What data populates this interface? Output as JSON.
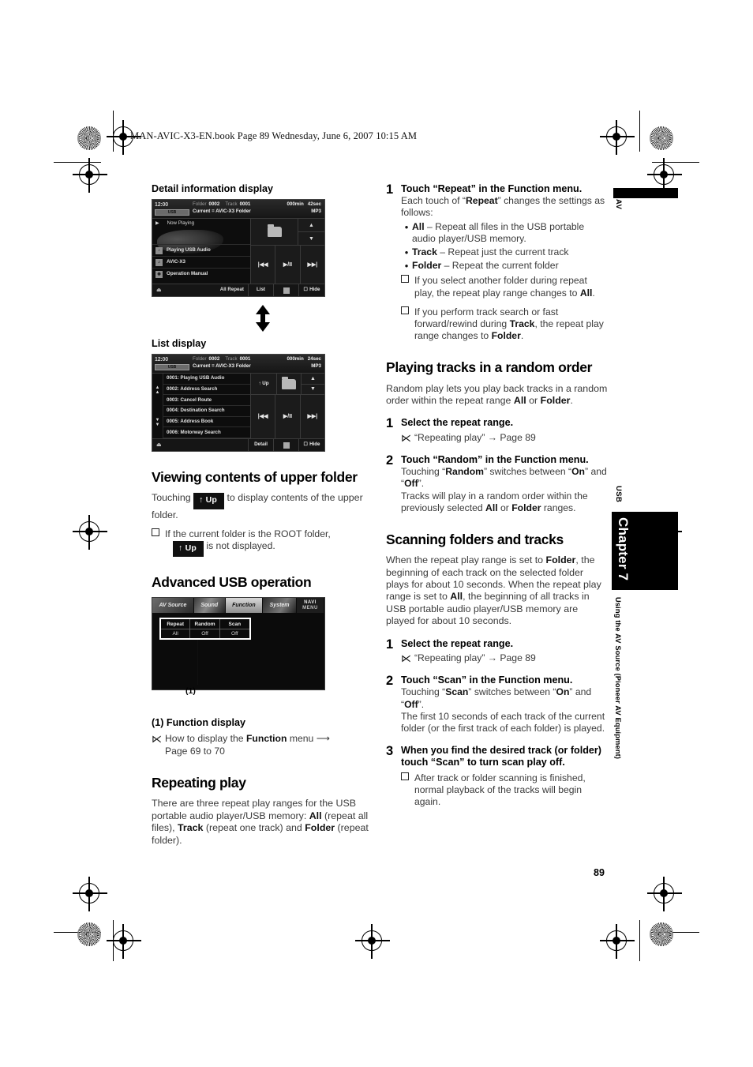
{
  "page": {
    "file_header": "MAN-AVIC-X3-EN.book  Page 89  Wednesday, June 6, 2007  10:15 AM",
    "page_number": "89",
    "margin": {
      "av_label": "AV",
      "usb_label": "USB",
      "chapter_label": "Chapter 7",
      "chapter_subtitle": "Using the AV Source (Pioneer AV Equipment)"
    }
  },
  "left_column": {
    "detail_caption": "Detail information display",
    "list_caption": "List display",
    "detail_screen": {
      "clock": "12:00",
      "clock_badge": "USB",
      "folder_label": "Folder",
      "folder_value": "0002",
      "track_label": "Track",
      "track_value": "0001",
      "elapsed": "000min",
      "seconds": "42sec",
      "format": "MP3",
      "current_label": "Current = AVIC-X3 Folder",
      "now_playing": "Now Playing",
      "info_rows": [
        "Playing USB Audio",
        "AVIC-X3",
        "Operation Manual"
      ],
      "repeat_status": "All Repeat",
      "btn_list": "List",
      "btn_hide": "Hide",
      "btn_prev": "|◀◀",
      "btn_play": "▶/II",
      "btn_next": "▶▶|",
      "btn_up": "▲",
      "btn_down": "▼"
    },
    "list_screen": {
      "clock": "12:00",
      "clock_badge": "USB",
      "folder_label": "Folder",
      "folder_value": "0002",
      "track_label": "Track",
      "track_value": "0001",
      "elapsed": "000min",
      "seconds": "24sec",
      "format": "MP3",
      "current_label": "Current = AVIC-X3 Folder",
      "items": [
        "0001: Playing USB Audio",
        "0002: Address Search",
        "0003: Cancel Route",
        "0004: Destination Search",
        "0005: Address Book",
        "0006: Motorway Search"
      ],
      "btn_up": "↑ Up",
      "btn_detail": "Detail",
      "btn_hide": "Hide"
    },
    "upper_folder": {
      "heading": "Viewing contents of upper folder",
      "text_before_key": "Touching",
      "key_label": "↑ Up",
      "text_after_key": "to display contents of the upper folder.",
      "note_before_key": "If the current folder is the ROOT folder,",
      "note_key_label": "↑ Up",
      "note_after_key": "is not displayed."
    },
    "advanced_usb": {
      "heading": "Advanced USB operation",
      "tabs": [
        "AV Source",
        "Sound",
        "Function",
        "System"
      ],
      "navi_menu_line1": "NAVI",
      "navi_menu_line2": "MENU",
      "cells": [
        {
          "title": "Repeat",
          "value": "All"
        },
        {
          "title": "Random",
          "value": "Off"
        },
        {
          "title": "Scan",
          "value": "Off"
        }
      ],
      "callout_number": "(1)",
      "callout_caption": "(1) Function display",
      "reference": "How to display the Function menu → Page 69 to 70",
      "reference_bold": "Function"
    },
    "repeating_play": {
      "heading": "Repeating play",
      "paragraph": "There are three repeat play ranges for the USB portable audio player/USB memory: All (repeat all files), Track (repeat one track) and Folder (repeat folder)."
    }
  },
  "right_column": {
    "repeat_step": {
      "num": "1",
      "head": "Touch “Repeat” in the Function menu.",
      "sub_line1": "Each touch of “Repeat” changes the settings",
      "sub_line2": "as follows:",
      "bullets": [
        {
          "term": "All",
          "desc": "– Repeat all files in the USB portable audio player/USB memory."
        },
        {
          "term": "Track",
          "desc": "– Repeat just the current track"
        },
        {
          "term": "Folder",
          "desc": "– Repeat the current folder"
        }
      ],
      "note1": "If you select another folder during repeat play, the repeat play range changes to All.",
      "note2": "If you perform track search or fast forward/rewind during Track, the repeat play range changes to Folder."
    },
    "random": {
      "heading": "Playing tracks in a random order",
      "intro": "Random play lets you play back tracks in a random order within the repeat range All or Folder.",
      "step1": {
        "num": "1",
        "head": "Select the repeat range.",
        "ref": "“Repeating play” → Page 89"
      },
      "step2": {
        "num": "2",
        "head": "Touch “Random” in the Function menu.",
        "sub1": "Touching “Random” switches between “On” and “Off”.",
        "sub2": "Tracks will play in a random order within the previously selected All or Folder ranges."
      }
    },
    "scanning": {
      "heading": "Scanning folders and tracks",
      "intro": "When the repeat play range is set to Folder, the beginning of each track on the selected folder plays for about 10 seconds. When the repeat play range is set to All, the beginning of all tracks in USB portable audio player/USB memory are played for about 10 seconds.",
      "step1": {
        "num": "1",
        "head": "Select the repeat range.",
        "ref": "“Repeating play” → Page 89"
      },
      "step2": {
        "num": "2",
        "head": "Touch “Scan” in the Function menu.",
        "sub1": "Touching “Scan” switches between “On” and “Off”.",
        "sub2": "The first 10 seconds of each track of the current folder (or the first track of each folder) is played."
      },
      "step3": {
        "num": "3",
        "head": "When you find the desired track (or folder) touch “Scan” to turn scan play off.",
        "note": "After track or folder scanning is finished, normal playback of the tracks will begin again."
      }
    }
  }
}
